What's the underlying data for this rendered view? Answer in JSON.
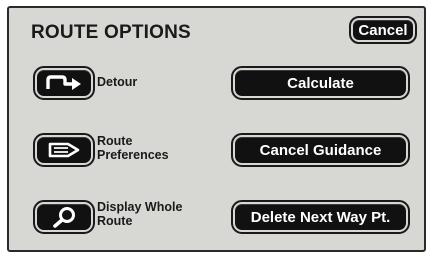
{
  "header": {
    "title": "ROUTE OPTIONS",
    "cancel_label": "Cancel"
  },
  "options": [
    {
      "label_line1": "Detour",
      "label_line2": "",
      "icon": "detour-arrow-icon"
    },
    {
      "label_line1": "Route",
      "label_line2": "Preferences",
      "icon": "route-preferences-icon"
    },
    {
      "label_line1": "Display Whole",
      "label_line2": "Route",
      "icon": "magnifier-icon"
    }
  ],
  "actions": {
    "calculate_label": "Calculate",
    "cancel_guidance_label": "Cancel Guidance",
    "delete_next_label": "Delete Next Way Pt."
  },
  "colors": {
    "panel_background": "#d7d7d4",
    "button_fill": "#111111",
    "button_text": "#ffffff",
    "text_dark": "#1a1a1a"
  }
}
